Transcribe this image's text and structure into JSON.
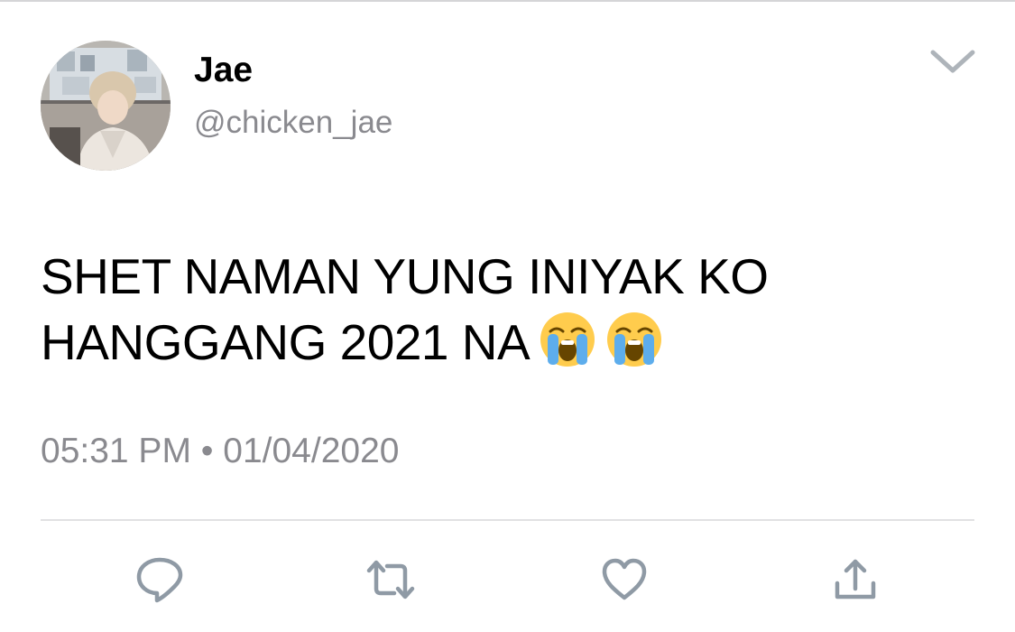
{
  "tweet": {
    "author": {
      "display_name": "Jae",
      "handle": "@chicken_jae"
    },
    "text_line_1": "SHET NAMAN YUNG INIYAK KO",
    "text_line_2": "HANGGANG 2021 NA",
    "emojis": [
      "loudly-crying-face",
      "loudly-crying-face"
    ],
    "time": "05:31 PM",
    "separator": "•",
    "date": "01/04/2020"
  },
  "actions": {
    "icons": [
      "reply-icon",
      "retweet-icon",
      "like-icon",
      "share-icon"
    ],
    "color": "#8f9aa5"
  },
  "colors": {
    "text": "#000000",
    "secondary_text": "#8a8a8f",
    "divider": "#e1e1e3",
    "chevron": "#aeb4ba"
  }
}
